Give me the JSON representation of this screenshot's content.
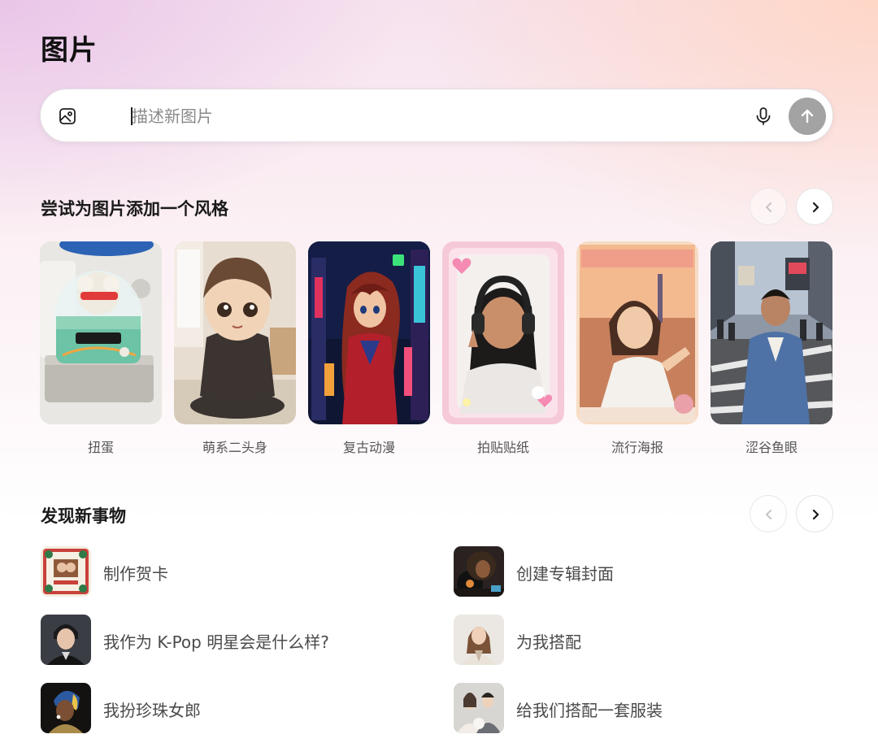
{
  "header": {
    "title": "图片"
  },
  "prompt": {
    "placeholder": "描述新图片",
    "value": ""
  },
  "style_section": {
    "title": "尝试为图片添加一个风格",
    "prev_enabled": false,
    "next_enabled": true,
    "items": [
      {
        "label": "扭蛋"
      },
      {
        "label": "萌系二头身"
      },
      {
        "label": "复古动漫"
      },
      {
        "label": "拍贴贴纸"
      },
      {
        "label": "流行海报"
      },
      {
        "label": "涩谷鱼眼"
      }
    ]
  },
  "discover_section": {
    "title": "发现新事物",
    "prev_enabled": false,
    "next_enabled": true,
    "items": [
      {
        "label": "制作贺卡"
      },
      {
        "label": "创建专辑封面"
      },
      {
        "label": "我作为 K-Pop 明星会是什么样?"
      },
      {
        "label": "为我搭配"
      },
      {
        "label": "我扮珍珠女郎"
      },
      {
        "label": "给我们搭配一套服装"
      }
    ]
  },
  "icons": {
    "prompt_leading": "image-icon",
    "microphone": "microphone-icon",
    "send": "arrow-up-icon",
    "prev": "chevron-left-icon",
    "next": "chevron-right-icon"
  },
  "colors": {
    "send_button": "#a3a3a3",
    "text_primary": "#1a1a1a",
    "text_secondary": "#555555"
  }
}
